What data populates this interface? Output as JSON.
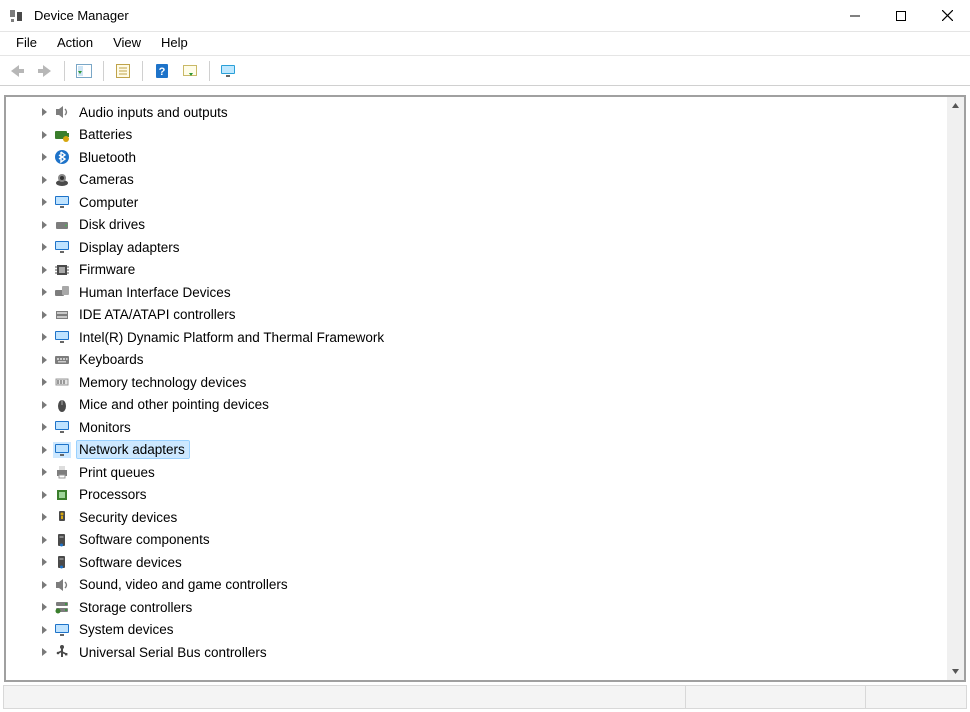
{
  "window": {
    "title": "Device Manager"
  },
  "menu": {
    "file": "File",
    "action": "Action",
    "view": "View",
    "help": "Help"
  },
  "toolbar": {
    "back_tip": "Back",
    "forward_tip": "Forward",
    "show_hide_tip": "Show/Hide Console Tree",
    "properties_tip": "Properties",
    "help_tip": "Help",
    "scan_tip": "Scan for hardware changes",
    "monitor_tip": "Add legacy hardware"
  },
  "tree": {
    "items": [
      {
        "label": "Audio inputs and outputs",
        "icon": "speaker"
      },
      {
        "label": "Batteries",
        "icon": "battery"
      },
      {
        "label": "Bluetooth",
        "icon": "bluetooth"
      },
      {
        "label": "Cameras",
        "icon": "camera"
      },
      {
        "label": "Computer",
        "icon": "monitor"
      },
      {
        "label": "Disk drives",
        "icon": "disk"
      },
      {
        "label": "Display adapters",
        "icon": "monitor"
      },
      {
        "label": "Firmware",
        "icon": "chip"
      },
      {
        "label": "Human Interface Devices",
        "icon": "hid"
      },
      {
        "label": "IDE ATA/ATAPI controllers",
        "icon": "ide"
      },
      {
        "label": "Intel(R) Dynamic Platform and Thermal Framework",
        "icon": "monitor"
      },
      {
        "label": "Keyboards",
        "icon": "keyboard"
      },
      {
        "label": "Memory technology devices",
        "icon": "memory"
      },
      {
        "label": "Mice and other pointing devices",
        "icon": "mouse"
      },
      {
        "label": "Monitors",
        "icon": "monitor"
      },
      {
        "label": "Network adapters",
        "icon": "monitor",
        "selected": true
      },
      {
        "label": "Print queues",
        "icon": "printer"
      },
      {
        "label": "Processors",
        "icon": "cpu"
      },
      {
        "label": "Security devices",
        "icon": "security"
      },
      {
        "label": "Software components",
        "icon": "sw"
      },
      {
        "label": "Software devices",
        "icon": "sw"
      },
      {
        "label": "Sound, video and game controllers",
        "icon": "speaker"
      },
      {
        "label": "Storage controllers",
        "icon": "storage"
      },
      {
        "label": "System devices",
        "icon": "monitor"
      },
      {
        "label": "Universal Serial Bus controllers",
        "icon": "usb"
      }
    ]
  }
}
